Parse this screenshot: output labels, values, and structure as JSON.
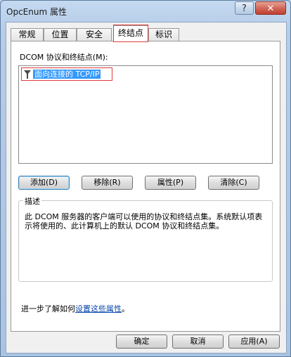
{
  "window": {
    "title": "OpcEnum 属性",
    "help": "?",
    "close": "✕"
  },
  "tabs": [
    {
      "label": "常规"
    },
    {
      "label": "位置"
    },
    {
      "label": "安全"
    },
    {
      "label": "终结点"
    },
    {
      "label": "标识"
    }
  ],
  "active_tab": "终结点",
  "protocols": {
    "label": "DCOM 协议和终结点(M):",
    "items": [
      {
        "label": "面向连接的 TCP/IP",
        "selected": true
      }
    ]
  },
  "buttons": {
    "add": "添加(D)",
    "remove": "移除(R)",
    "properties": "属性(P)",
    "clear": "清除(C)"
  },
  "description": {
    "title": "描述",
    "text": "此 DCOM 服务器的客户端可以使用的协议和终结点集。系统默认项表示将使用的、此计算机上的默认 DCOM 协议和终结点集。"
  },
  "learn_more": {
    "prefix": "进一步了解如何",
    "link": "设置这些属性",
    "suffix": "。"
  },
  "footer": {
    "ok": "确定",
    "cancel": "取消",
    "apply": "应用(A)"
  },
  "colors": {
    "selection": "#3399ff",
    "annotation": "#e23b3b",
    "link": "#0645ad"
  }
}
